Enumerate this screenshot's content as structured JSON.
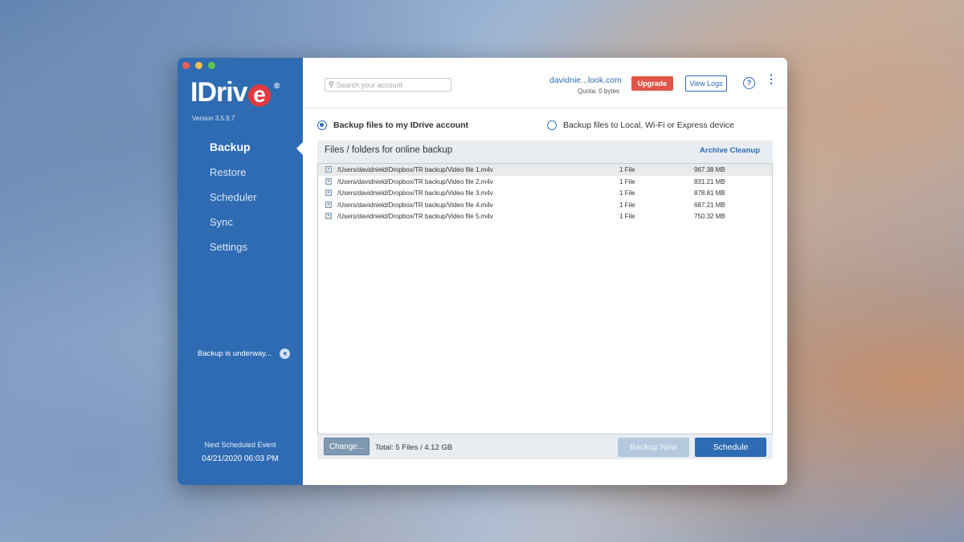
{
  "app": {
    "name": "IDrive",
    "version": "Version 3.5.9.7"
  },
  "sidebar": {
    "items": [
      {
        "label": "Backup",
        "active": true
      },
      {
        "label": "Restore"
      },
      {
        "label": "Scheduler"
      },
      {
        "label": "Sync"
      },
      {
        "label": "Settings"
      }
    ],
    "status_text": "Backup is underway...",
    "next_scheduled_label": "Next Scheduled Event",
    "next_scheduled_date": "04/21/2020 06:03 PM"
  },
  "header": {
    "search_placeholder": "Search your account",
    "account": "davidnie...look.com",
    "quota": "Quota: 0 bytes",
    "upgrade_label": "Upgrade",
    "view_logs_label": "View Logs",
    "help_glyph": "?",
    "more_glyph": "⋮"
  },
  "backup_options": {
    "online_label": "Backup files to my IDrive account",
    "local_label": "Backup files to Local, Wi-Fi or Express device",
    "selected": "online"
  },
  "panel": {
    "title": "Files / folders for online backup",
    "archive_cleanup_label": "Archive Cleanup",
    "files": [
      {
        "path": "/Users/davidnield/Dropbox/TR backup/Video file 1.m4v",
        "count": "1 File",
        "size": "967.38 MB"
      },
      {
        "path": "/Users/davidnield/Dropbox/TR backup/Video file 2.m4v",
        "count": "1 File",
        "size": "831.21 MB"
      },
      {
        "path": "/Users/davidnield/Dropbox/TR backup/Video file 3.m4v",
        "count": "1 File",
        "size": "878.81 MB"
      },
      {
        "path": "/Users/davidnield/Dropbox/TR backup/Video file 4.m4v",
        "count": "1 File",
        "size": "687.21 MB"
      },
      {
        "path": "/Users/davidnield/Dropbox/TR backup/Video file 5.m4v",
        "count": "1 File",
        "size": "750.32 MB"
      }
    ],
    "change_label": "Change...",
    "total_text": "Total: 5 Files / 4.12 GB",
    "backup_now_label": "Backup Now",
    "schedule_label": "Schedule"
  },
  "colors": {
    "brand_blue": "#2e6bb3",
    "upgrade_red": "#e05548",
    "logo_red": "#e0393e"
  }
}
